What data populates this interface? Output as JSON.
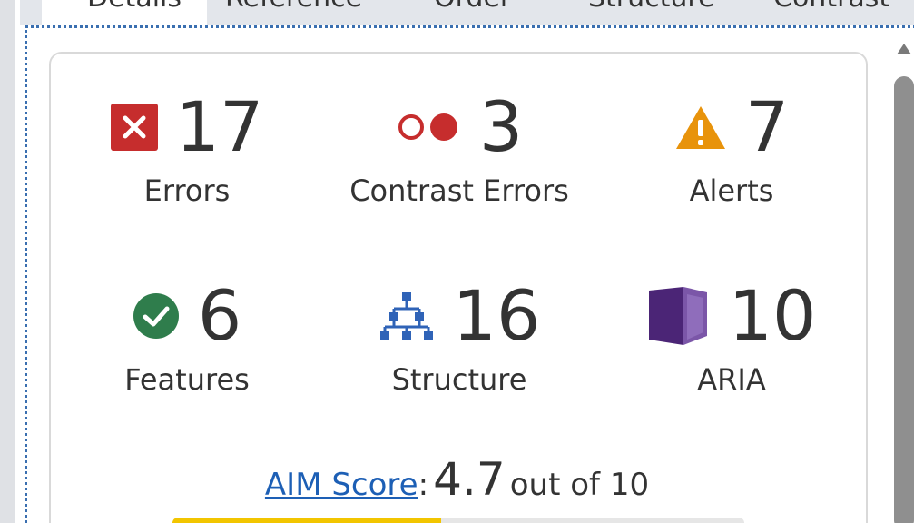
{
  "tabs": [
    {
      "label": "Details",
      "active": true
    },
    {
      "label": "Reference",
      "active": false
    },
    {
      "label": "Order",
      "active": false
    },
    {
      "label": "Structure",
      "active": false
    },
    {
      "label": "Contrast",
      "active": false
    }
  ],
  "summary": {
    "errors": {
      "count": "17",
      "label": "Errors",
      "icon": "error-x-icon",
      "color": "#c62d2d"
    },
    "contrast_errors": {
      "count": "3",
      "label": "Contrast Errors",
      "icon": "contrast-icon",
      "color": "#c62d2d"
    },
    "alerts": {
      "count": "7",
      "label": "Alerts",
      "icon": "alert-triangle-icon",
      "color": "#e8930b"
    },
    "features": {
      "count": "6",
      "label": "Features",
      "icon": "check-circle-icon",
      "color": "#2f7d4c"
    },
    "structure": {
      "count": "16",
      "label": "Structure",
      "icon": "hierarchy-icon",
      "color": "#2f63b7"
    },
    "aria": {
      "count": "10",
      "label": "ARIA",
      "icon": "aria-cube-icon",
      "color": "#5b2c86"
    }
  },
  "aim_score": {
    "link_label": "AIM Score",
    "separator": ":",
    "value": "4.7",
    "suffix": "out of 10",
    "score": 4.7,
    "max": 10,
    "bar_color": "#f2c500"
  }
}
